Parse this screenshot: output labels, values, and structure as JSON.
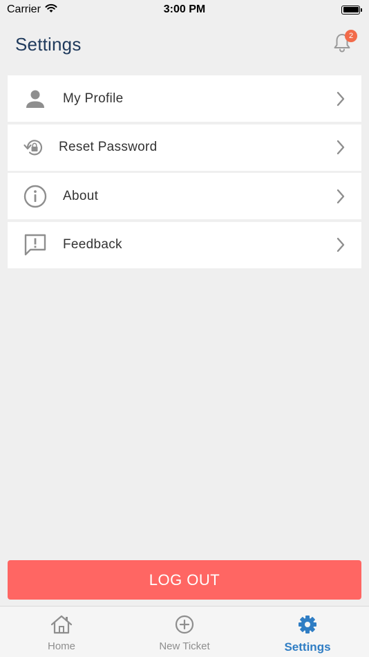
{
  "status_bar": {
    "carrier": "Carrier",
    "time": "3:00 PM"
  },
  "header": {
    "title": "Settings",
    "notification_count": "2"
  },
  "settings": {
    "items": [
      {
        "label": "My Profile",
        "icon": "person-icon"
      },
      {
        "label": "Reset Password",
        "icon": "reset-lock-icon"
      },
      {
        "label": "About",
        "icon": "info-icon"
      },
      {
        "label": "Feedback",
        "icon": "feedback-icon"
      }
    ]
  },
  "logout": {
    "label": "LOG OUT"
  },
  "tabs": [
    {
      "label": "Home",
      "icon": "home-icon",
      "active": false
    },
    {
      "label": "New Ticket",
      "icon": "plus-circle-icon",
      "active": false
    },
    {
      "label": "Settings",
      "icon": "gear-icon",
      "active": true
    }
  ],
  "colors": {
    "title": "#1f3a5c",
    "badge": "#f26b4a",
    "logout": "#ff6663",
    "active_tab": "#2f7dc4",
    "icon_gray": "#8e8e8e"
  }
}
